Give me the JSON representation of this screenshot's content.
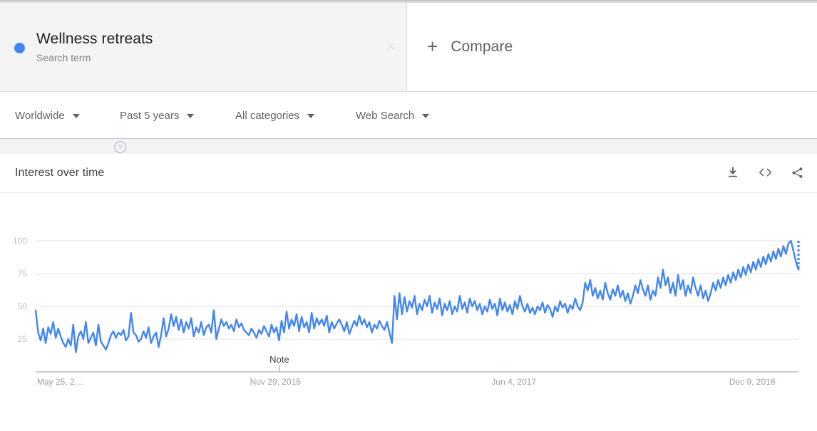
{
  "header": {
    "search_term": {
      "label": "Wellness retreats",
      "type_label": "Search term",
      "dot_color": "#4285f4",
      "remove_label": "×"
    },
    "compare": {
      "plus": "+",
      "label": "Compare"
    }
  },
  "filters": [
    {
      "name": "location",
      "label": "Worldwide"
    },
    {
      "name": "time-range",
      "label": "Past 5 years"
    },
    {
      "name": "category",
      "label": "All categories"
    },
    {
      "name": "search-type",
      "label": "Web Search"
    }
  ],
  "chart_card": {
    "title": "Interest over time",
    "help_icon": "help-circle-icon",
    "actions": [
      {
        "name": "download",
        "icon": "download-icon"
      },
      {
        "name": "embed",
        "icon": "embed-code-icon"
      },
      {
        "name": "share",
        "icon": "share-icon"
      }
    ]
  },
  "chart_data": {
    "type": "line",
    "title": "Interest over time",
    "subtitle": "Wellness retreats — Search term",
    "xlabel": "",
    "ylabel": "",
    "ylim": [
      0,
      100
    ],
    "yticks": [
      25,
      50,
      75,
      100
    ],
    "grid": true,
    "legend_position": "none",
    "series_name": "Wellness retreats",
    "series_color": "#4285f4",
    "xtick_labels": [
      "May 25, 2…",
      "Nov 29, 2015",
      "Jun 4, 2017",
      "Dec 9, 2018"
    ],
    "xtick_positions": [
      0,
      0.3125,
      0.625,
      0.9375
    ],
    "annotations": [
      {
        "label": "Note",
        "x_fraction": 0.3195
      }
    ],
    "partial_data_tail": true,
    "values": [
      47,
      30,
      24,
      33,
      22,
      34,
      29,
      38,
      26,
      33,
      27,
      22,
      19,
      25,
      20,
      36,
      15,
      27,
      31,
      25,
      38,
      22,
      26,
      30,
      20,
      36,
      23,
      20,
      17,
      22,
      28,
      31,
      26,
      30,
      28,
      32,
      24,
      27,
      45,
      30,
      28,
      23,
      25,
      31,
      26,
      34,
      22,
      27,
      30,
      19,
      28,
      41,
      27,
      33,
      44,
      35,
      42,
      32,
      40,
      30,
      38,
      33,
      41,
      27,
      34,
      30,
      38,
      28,
      34,
      36,
      30,
      47,
      25,
      33,
      40,
      35,
      38,
      33,
      36,
      31,
      40,
      34,
      37,
      32,
      30,
      28,
      33,
      30,
      26,
      32,
      29,
      35,
      31,
      27,
      36,
      30,
      34,
      24,
      39,
      30,
      46,
      33,
      40,
      35,
      44,
      31,
      42,
      34,
      38,
      30,
      45,
      33,
      41,
      36,
      40,
      35,
      43,
      30,
      38,
      33,
      37,
      40,
      36,
      31,
      38,
      29,
      34,
      39,
      35,
      43,
      36,
      40,
      34,
      38,
      30,
      36,
      33,
      39,
      35,
      32,
      38,
      30,
      22,
      58,
      40,
      60,
      44,
      57,
      46,
      54,
      49,
      58,
      44,
      52,
      47,
      55,
      50,
      58,
      45,
      53,
      48,
      56,
      43,
      52,
      47,
      54,
      44,
      50,
      46,
      58,
      48,
      53,
      45,
      56,
      50,
      54,
      47,
      52,
      44,
      50,
      46,
      55,
      48,
      52,
      43,
      56,
      47,
      53,
      46,
      51,
      44,
      54,
      48,
      58,
      50,
      46,
      52,
      45,
      49,
      44,
      50,
      47,
      53,
      45,
      51,
      48,
      42,
      50,
      46,
      54,
      49,
      52,
      45,
      51,
      48,
      56,
      50,
      47,
      53,
      68,
      62,
      70,
      58,
      64,
      56,
      62,
      55,
      68,
      60,
      55,
      63,
      58,
      66,
      57,
      62,
      54,
      60,
      52,
      58,
      66,
      60,
      70,
      63,
      58,
      66,
      55,
      62,
      58,
      72,
      64,
      78,
      66,
      72,
      60,
      68,
      58,
      74,
      63,
      70,
      58,
      66,
      60,
      72,
      64,
      58,
      66,
      56,
      62,
      54,
      60,
      68,
      62,
      70,
      64,
      72,
      66,
      74,
      68,
      76,
      70,
      78,
      72,
      80,
      74,
      82,
      76,
      84,
      78,
      86,
      80,
      88,
      82,
      90,
      84,
      92,
      86,
      94,
      88,
      96,
      90,
      98,
      100,
      92,
      84,
      78
    ]
  }
}
